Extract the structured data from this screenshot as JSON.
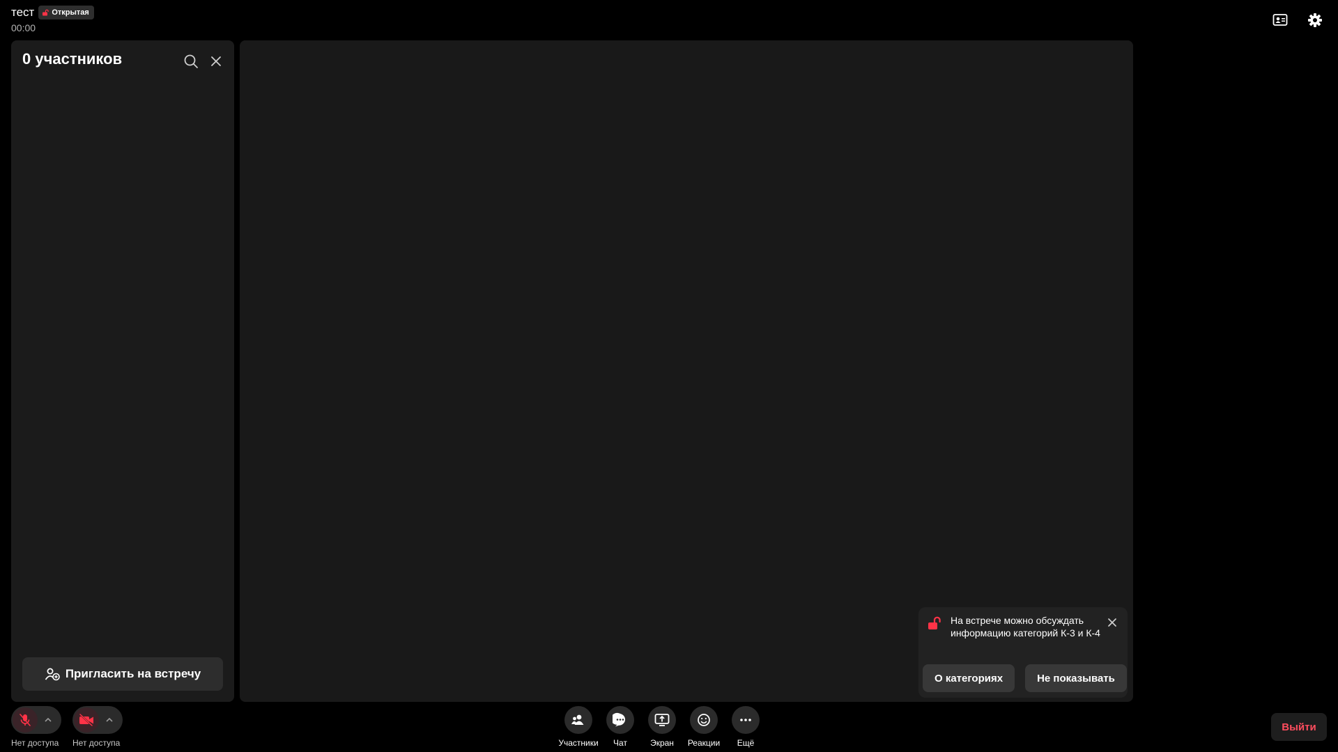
{
  "header": {
    "title": "тест",
    "badge": {
      "label": "Открытая",
      "icon": "lock-open-icon",
      "color": "#ff3347"
    },
    "timer": "00:00",
    "icons": [
      "contact-card-icon",
      "gear-icon"
    ]
  },
  "participants_panel": {
    "title": "0 участников",
    "search_icon": "search-icon",
    "close_icon": "close-icon",
    "invite_label": "Пригласить на встречу",
    "invite_icon": "add-person-icon"
  },
  "notice": {
    "icon": "lock-open-icon",
    "text": "На встрече можно обсуждать информацию категорий К-3 и К-4",
    "about_label": "О категориях",
    "dismiss_label": "Не показывать"
  },
  "bottom": {
    "mic": {
      "label": "Нет доступа",
      "icon": "mic-off-icon"
    },
    "camera": {
      "label": "Нет доступа",
      "icon": "camera-off-icon"
    },
    "controls": [
      {
        "label": "Участники",
        "icon": "participants-icon"
      },
      {
        "label": "Чат",
        "icon": "chat-icon"
      },
      {
        "label": "Экран",
        "icon": "screen-share-icon"
      },
      {
        "label": "Реакции",
        "icon": "smile-icon"
      },
      {
        "label": "Ещё",
        "icon": "more-icon"
      }
    ],
    "leave_label": "Выйти"
  },
  "colors": {
    "accent_red": "#ff3347",
    "background": "#000000",
    "panel": "#1b1b1b",
    "stage": "#191919"
  }
}
